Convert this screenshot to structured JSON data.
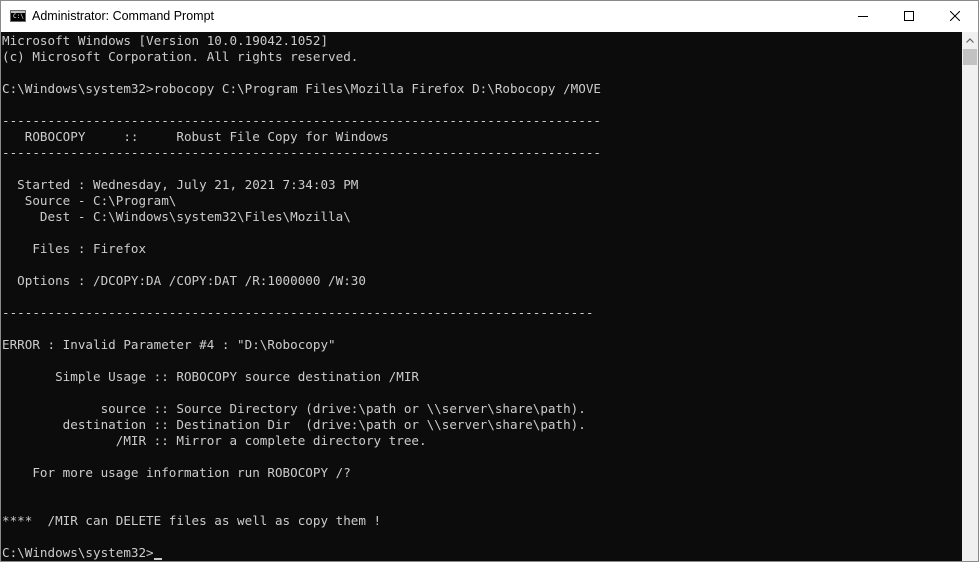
{
  "window": {
    "title": "Administrator: Command Prompt",
    "icon_label": "C:\\",
    "controls": {
      "minimize": "minimize-icon",
      "maximize": "maximize-icon",
      "close": "close-icon"
    }
  },
  "colors": {
    "console_bg": "#0c0c0c",
    "console_fg": "#cccccc",
    "titlebar_bg": "#ffffff",
    "scrollbar_bg": "#f0f0f0"
  },
  "console": {
    "lines": [
      {
        "row": 0,
        "text": "Microsoft Windows [Version 10.0.19042.1052]"
      },
      {
        "row": 1,
        "text": "(c) Microsoft Corporation. All rights reserved."
      },
      {
        "row": 3,
        "text": "C:\\Windows\\system32>robocopy C:\\Program Files\\Mozilla Firefox D:\\Robocopy /MOVE"
      },
      {
        "row": 5,
        "text": "-------------------------------------------------------------------------------"
      },
      {
        "row": 6,
        "text": "   ROBOCOPY     ::     Robust File Copy for Windows"
      },
      {
        "row": 7,
        "text": "-------------------------------------------------------------------------------"
      },
      {
        "row": 9,
        "text": "  Started : Wednesday, July 21, 2021 7:34:03 PM"
      },
      {
        "row": 10,
        "text": "   Source - C:\\Program\\"
      },
      {
        "row": 11,
        "text": "     Dest - C:\\Windows\\system32\\Files\\Mozilla\\"
      },
      {
        "row": 13,
        "text": "    Files : Firefox"
      },
      {
        "row": 15,
        "text": "  Options : /DCOPY:DA /COPY:DAT /R:1000000 /W:30"
      },
      {
        "row": 17,
        "text": "------------------------------------------------------------------------------"
      },
      {
        "row": 19,
        "text": "ERROR : Invalid Parameter #4 : \"D:\\Robocopy\""
      },
      {
        "row": 21,
        "text": "       Simple Usage :: ROBOCOPY source destination /MIR"
      },
      {
        "row": 23,
        "text": "             source :: Source Directory (drive:\\path or \\\\server\\share\\path)."
      },
      {
        "row": 24,
        "text": "        destination :: Destination Dir  (drive:\\path or \\\\server\\share\\path)."
      },
      {
        "row": 25,
        "text": "               /MIR :: Mirror a complete directory tree."
      },
      {
        "row": 27,
        "text": "    For more usage information run ROBOCOPY /?"
      },
      {
        "row": 30,
        "text": "****  /MIR can DELETE files as well as copy them !"
      }
    ],
    "prompt": {
      "row": 32,
      "text": "C:\\Windows\\system32>"
    }
  }
}
